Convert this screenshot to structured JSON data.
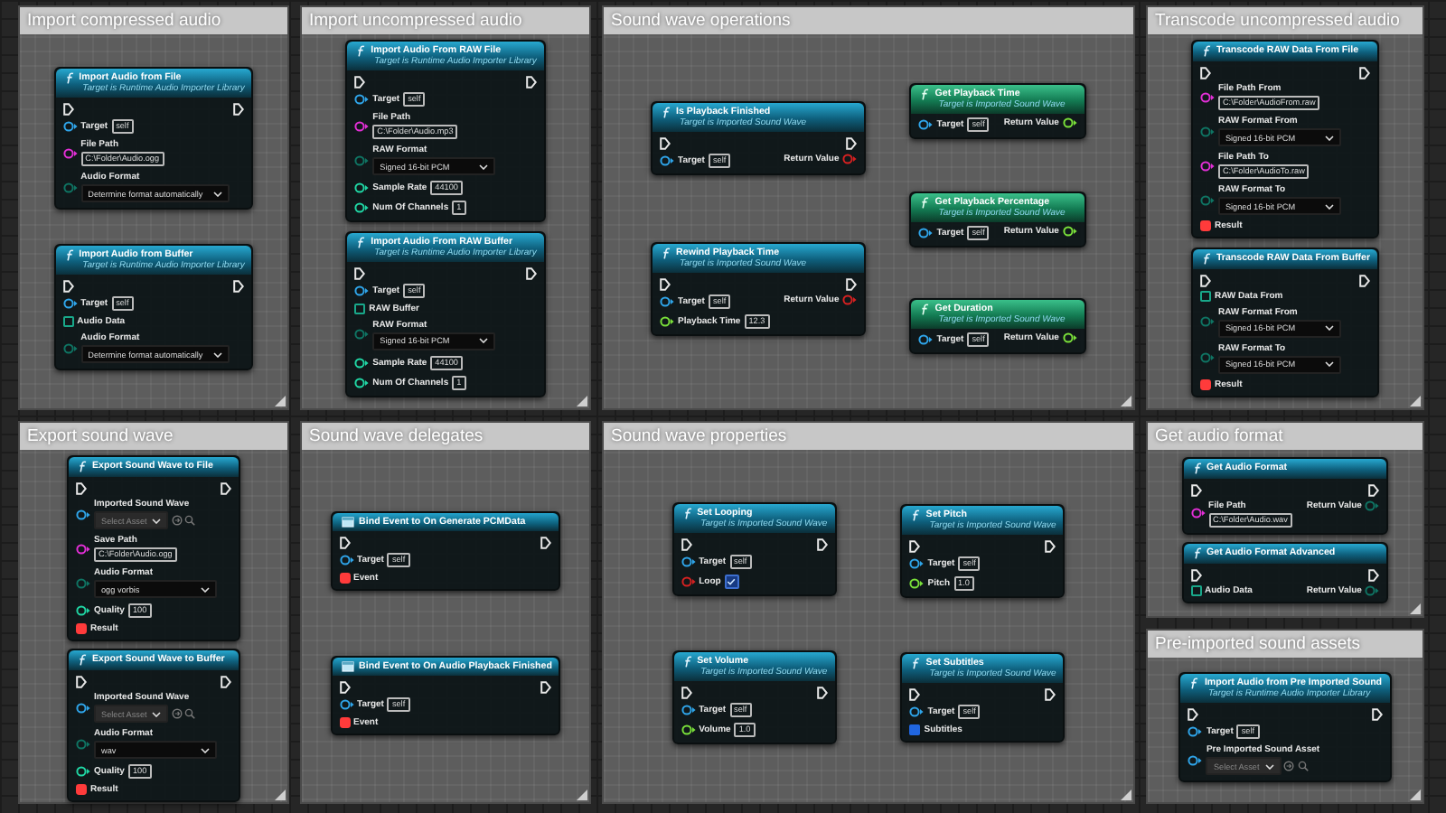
{
  "comments": [
    {
      "title": "Import compressed audio",
      "columns": [
        [
          {
            "title": "Import Audio from File",
            "subtitle": "Target is Runtime Audio Importer Library",
            "kind": "function",
            "exec": true,
            "left": [
              {
                "label": "Target",
                "kind": "object",
                "value": "self"
              },
              {
                "label": "File Path",
                "kind": "string",
                "value": "C:\\Folder\\Audio.ogg"
              },
              {
                "label": "Audio Format",
                "kind": "enum",
                "value": "Determine format automatically"
              }
            ]
          },
          {
            "title": "Import Audio from Buffer",
            "subtitle": "Target is Runtime Audio Importer Library",
            "kind": "function",
            "exec": true,
            "left": [
              {
                "label": "Target",
                "kind": "object",
                "value": "self"
              },
              {
                "label": "Audio Data",
                "kind": "array"
              },
              {
                "label": "Audio Format",
                "kind": "enum",
                "value": "Determine format automatically"
              }
            ]
          }
        ]
      ]
    },
    {
      "title": "Import uncompressed audio",
      "columns": [
        [
          {
            "title": "Import Audio From RAW File",
            "subtitle": "Target is Runtime Audio Importer Library",
            "kind": "function",
            "exec": true,
            "left": [
              {
                "label": "Target",
                "kind": "object",
                "value": "self"
              },
              {
                "label": "File Path",
                "kind": "string",
                "value": "C:\\Folder\\Audio.mp3"
              },
              {
                "label": "RAW Format",
                "kind": "enum",
                "value": "Signed 16-bit PCM"
              },
              {
                "label": "Sample Rate",
                "kind": "int",
                "value": "44100"
              },
              {
                "label": "Num Of Channels",
                "kind": "int",
                "value": "1"
              }
            ]
          },
          {
            "title": "Import Audio From RAW Buffer",
            "subtitle": "Target is Runtime Audio Importer Library",
            "kind": "function",
            "exec": true,
            "left": [
              {
                "label": "Target",
                "kind": "object",
                "value": "self"
              },
              {
                "label": "RAW Buffer",
                "kind": "array"
              },
              {
                "label": "RAW Format",
                "kind": "enum",
                "value": "Signed 16-bit PCM"
              },
              {
                "label": "Sample Rate",
                "kind": "int",
                "value": "44100"
              },
              {
                "label": "Num Of Channels",
                "kind": "int",
                "value": "1"
              }
            ]
          }
        ]
      ]
    },
    {
      "title": "Sound wave operations",
      "columns": [
        [
          {
            "title": "Is Playback Finished",
            "subtitle": "Target is Imported Sound Wave",
            "kind": "function",
            "exec": true,
            "left": [
              {
                "label": "Target",
                "kind": "object",
                "value": "self"
              }
            ],
            "right": [
              {
                "label": "Return Value",
                "kind": "bool"
              }
            ]
          },
          {
            "title": "Rewind Playback Time",
            "subtitle": "Target is Imported Sound Wave",
            "kind": "function",
            "exec": true,
            "left": [
              {
                "label": "Target",
                "kind": "object",
                "value": "self"
              },
              {
                "label": "Playback Time",
                "kind": "float",
                "value": "12.3"
              }
            ],
            "right": [
              {
                "label": "Return Value",
                "kind": "bool"
              }
            ]
          }
        ],
        [
          {
            "title": "Get Playback Time",
            "subtitle": "Target is Imported Sound Wave",
            "kind": "pure",
            "exec": false,
            "left": [
              {
                "label": "Target",
                "kind": "object",
                "value": "self"
              }
            ],
            "right": [
              {
                "label": "Return Value",
                "kind": "float"
              }
            ]
          },
          {
            "title": "Get Playback Percentage",
            "subtitle": "Target is Imported Sound Wave",
            "kind": "pure",
            "exec": false,
            "left": [
              {
                "label": "Target",
                "kind": "object",
                "value": "self"
              }
            ],
            "right": [
              {
                "label": "Return Value",
                "kind": "float"
              }
            ]
          },
          {
            "title": "Get Duration",
            "subtitle": "Target is Imported Sound Wave",
            "kind": "pure",
            "exec": false,
            "left": [
              {
                "label": "Target",
                "kind": "object",
                "value": "self"
              }
            ],
            "right": [
              {
                "label": "Return Value",
                "kind": "float"
              }
            ]
          }
        ]
      ]
    },
    {
      "title": "Transcode uncompressed audio",
      "columns": [
        [
          {
            "title": "Transcode RAW Data From File",
            "kind": "function",
            "exec": true,
            "left": [
              {
                "label": "File Path From",
                "kind": "string",
                "value": "C:\\Folder\\AudioFrom.raw"
              },
              {
                "label": "RAW Format From",
                "kind": "enum",
                "value": "Signed 16-bit PCM"
              },
              {
                "label": "File Path To",
                "kind": "string",
                "value": "C:\\Folder\\AudioTo.raw"
              },
              {
                "label": "RAW Format To",
                "kind": "enum",
                "value": "Signed 16-bit PCM"
              },
              {
                "label": "Result",
                "kind": "delegate"
              }
            ]
          },
          {
            "title": "Transcode RAW Data From Buffer",
            "kind": "function",
            "exec": true,
            "left": [
              {
                "label": "RAW Data From",
                "kind": "array"
              },
              {
                "label": "RAW Format From",
                "kind": "enum",
                "value": "Signed 16-bit PCM"
              },
              {
                "label": "RAW Format To",
                "kind": "enum",
                "value": "Signed 16-bit PCM"
              },
              {
                "label": "Result",
                "kind": "delegate"
              }
            ]
          }
        ]
      ]
    },
    {
      "title": "Export sound wave",
      "columns": [
        [
          {
            "title": "Export Sound Wave to File",
            "kind": "function",
            "exec": true,
            "left": [
              {
                "label": "Imported Sound Wave",
                "kind": "asset",
                "value": "Select Asset"
              },
              {
                "label": "Save Path",
                "kind": "string",
                "value": "C:\\Folder\\Audio.ogg"
              },
              {
                "label": "Audio Format",
                "kind": "enum",
                "value": "ogg vorbis"
              },
              {
                "label": "Quality",
                "kind": "int",
                "value": "100"
              },
              {
                "label": "Result",
                "kind": "delegate"
              }
            ]
          },
          {
            "title": "Export Sound Wave to Buffer",
            "kind": "function",
            "exec": true,
            "left": [
              {
                "label": "Imported Sound Wave",
                "kind": "asset",
                "value": "Select Asset"
              },
              {
                "label": "Audio Format",
                "kind": "enum",
                "value": "wav"
              },
              {
                "label": "Quality",
                "kind": "int",
                "value": "100"
              },
              {
                "label": "Result",
                "kind": "delegate"
              }
            ]
          }
        ]
      ]
    },
    {
      "title": "Sound wave delegates",
      "columns": [
        [
          {
            "title": "Bind Event to On Generate PCMData",
            "kind": "delegate",
            "exec": true,
            "left": [
              {
                "label": "Target",
                "kind": "object",
                "value": "self"
              },
              {
                "label": "Event",
                "kind": "delegate"
              }
            ]
          },
          {
            "title": "Bind Event to On Audio Playback Finished",
            "kind": "delegate",
            "exec": true,
            "left": [
              {
                "label": "Target",
                "kind": "object",
                "value": "self"
              },
              {
                "label": "Event",
                "kind": "delegate"
              }
            ]
          }
        ]
      ]
    },
    {
      "title": "Sound wave properties",
      "columns": [
        [
          {
            "title": "Set Looping",
            "subtitle": "Target is Imported Sound Wave",
            "kind": "function",
            "exec": true,
            "left": [
              {
                "label": "Target",
                "kind": "object",
                "value": "self"
              },
              {
                "label": "Loop",
                "kind": "bool",
                "checked": true
              }
            ]
          },
          {
            "title": "Set Volume",
            "subtitle": "Target is Imported Sound Wave",
            "kind": "function",
            "exec": true,
            "left": [
              {
                "label": "Target",
                "kind": "object",
                "value": "self"
              },
              {
                "label": "Volume",
                "kind": "float",
                "value": "1.0"
              }
            ]
          }
        ],
        [
          {
            "title": "Set Pitch",
            "subtitle": "Target is Imported Sound Wave",
            "kind": "function",
            "exec": true,
            "left": [
              {
                "label": "Target",
                "kind": "object",
                "value": "self"
              },
              {
                "label": "Pitch",
                "kind": "float",
                "value": "1.0"
              }
            ]
          },
          {
            "title": "Set Subtitles",
            "subtitle": "Target is Imported Sound Wave",
            "kind": "function",
            "exec": true,
            "left": [
              {
                "label": "Target",
                "kind": "object",
                "value": "self"
              },
              {
                "label": "Subtitles",
                "kind": "struct"
              }
            ]
          }
        ]
      ]
    },
    {
      "title": "Get audio format",
      "columns": [
        [
          {
            "title": "Get Audio Format",
            "kind": "function",
            "exec": true,
            "left": [
              {
                "label": "File Path",
                "kind": "string",
                "value": "C:\\Folder\\Audio.wav"
              }
            ],
            "right": [
              {
                "label": "Return Value",
                "kind": "enum"
              }
            ]
          },
          {
            "title": "Get Audio Format Advanced",
            "kind": "function",
            "exec": true,
            "left": [
              {
                "label": "Audio Data",
                "kind": "array"
              }
            ],
            "right": [
              {
                "label": "Return Value",
                "kind": "enum"
              }
            ]
          }
        ]
      ]
    },
    {
      "title": "Pre-imported sound assets",
      "columns": [
        [
          {
            "title": "Import Audio from Pre Imported Sound",
            "subtitle": "Target is Runtime Audio Importer Library",
            "kind": "function",
            "exec": true,
            "left": [
              {
                "label": "Target",
                "kind": "object",
                "value": "self"
              },
              {
                "label": "Pre Imported Sound Asset",
                "kind": "asset",
                "value": "Select Asset"
              }
            ]
          }
        ]
      ]
    }
  ]
}
